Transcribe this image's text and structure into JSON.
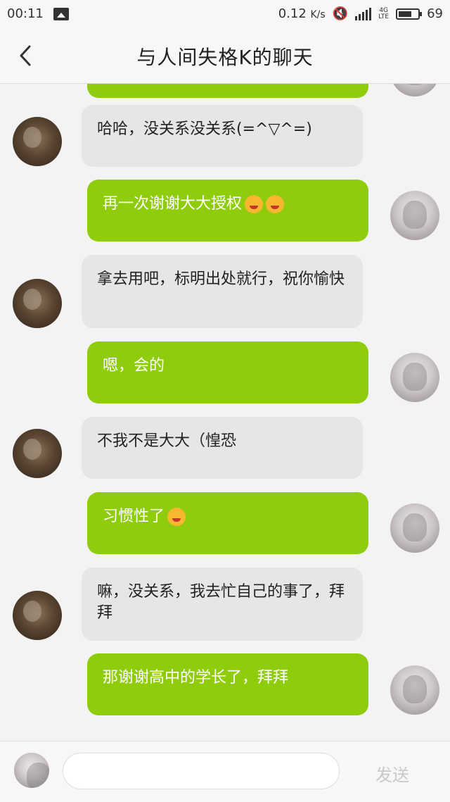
{
  "status": {
    "time": "00:11",
    "net_speed": "0.12",
    "net_unit": "K/s",
    "network_type": "4G",
    "network_sub": "LTE",
    "battery_level": "69"
  },
  "header": {
    "title": "与人间失格K的聊天"
  },
  "messages": [
    {
      "side": "left",
      "text": "哈哈，没关系没关系(=^▽^=)"
    },
    {
      "side": "right",
      "text": "再一次谢谢大大授权"
    },
    {
      "side": "left",
      "text": "拿去用吧，标明出处就行，祝你愉快"
    },
    {
      "side": "right",
      "text": "嗯，会的"
    },
    {
      "side": "left",
      "text": "不我不是大大（惶恐"
    },
    {
      "side": "right",
      "text": "习惯性了"
    },
    {
      "side": "left",
      "text": "嘛，没关系，我去忙自己的事了，拜拜"
    },
    {
      "side": "right",
      "text": "那谢谢高中的学长了，拜拜"
    }
  ],
  "input": {
    "placeholder": "",
    "send_label": "发送"
  }
}
